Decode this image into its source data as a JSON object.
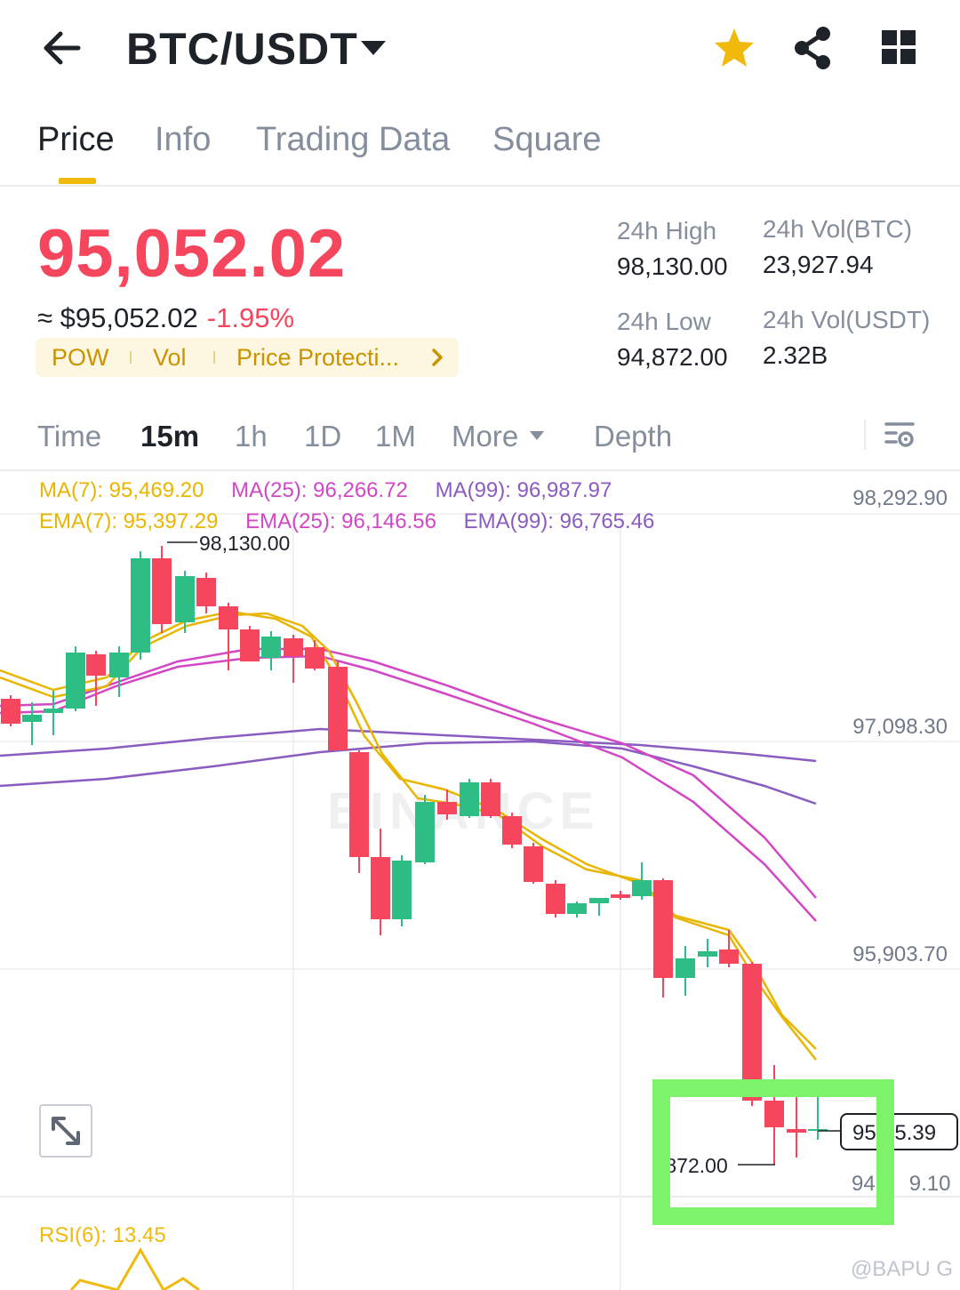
{
  "header": {
    "pair": "BTC/USDT"
  },
  "tabs": [
    {
      "label": "Price"
    },
    {
      "label": "Info"
    },
    {
      "label": "Trading Data"
    },
    {
      "label": "Square"
    }
  ],
  "price": {
    "last": "95,052.02",
    "approx": "≈ $95,052.02",
    "change": "-1.95%",
    "tags": [
      "POW",
      "Vol",
      "Price Protecti..."
    ]
  },
  "stats": {
    "high_label": "24h High",
    "high_value": "98,130.00",
    "low_label": "24h Low",
    "low_value": "94,872.00",
    "vol_btc_label": "24h Vol(BTC)",
    "vol_btc_value": "23,927.94",
    "vol_usdt_label": "24h Vol(USDT)",
    "vol_usdt_value": "2.32B"
  },
  "intervals": [
    {
      "label": "Time"
    },
    {
      "label": "15m"
    },
    {
      "label": "1h"
    },
    {
      "label": "1D"
    },
    {
      "label": "1M"
    },
    {
      "label": "More"
    },
    {
      "label": "Depth"
    }
  ],
  "indicators": {
    "ma7": "MA(7): 95,469.20",
    "ma25": "MA(25): 96,266.72",
    "ma99": "MA(99): 96,987.97",
    "ema7": "EMA(7): 95,397.29",
    "ema25": "EMA(25): 96,146.56",
    "ema99": "EMA(99): 96,765.46"
  },
  "chart": {
    "axis": [
      "98,292.90",
      "97,098.30",
      "95,903.70"
    ],
    "axis_partial": "94,7",
    "axis_partial_tail": "9.10",
    "high_marker": "98,130.00",
    "low_marker": ",872.00",
    "current_tag_a": "95,",
    "current_tag_b": "5.39",
    "rsi": "RSI(6): 13.45",
    "watermark": "BINANCE"
  },
  "credit": "@BAPU G",
  "colors": {
    "up": "#2ebd85",
    "down": "#f6465d",
    "accent": "#f0b90b",
    "ma7": "#e8b600",
    "ma25": "#d346c6",
    "ma99": "#8a5cc0",
    "highlight_box": "#7df26b"
  }
}
